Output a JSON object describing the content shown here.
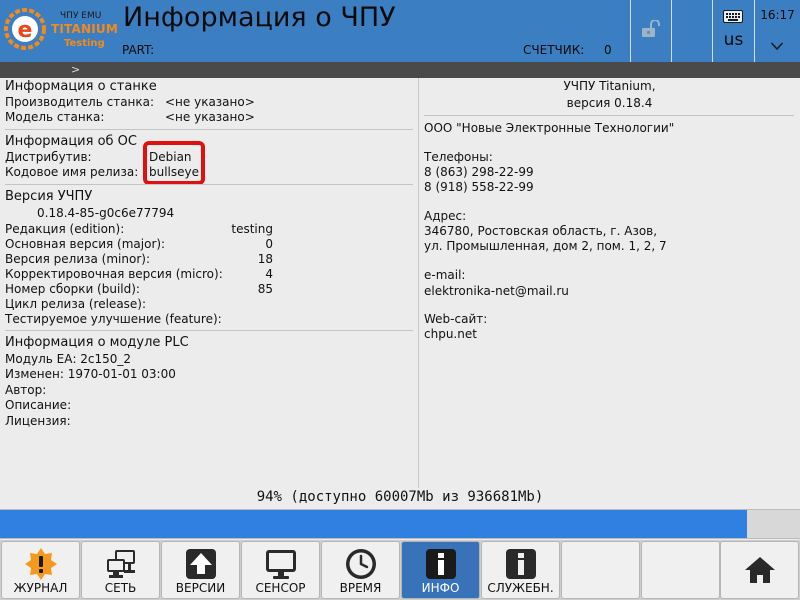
{
  "header": {
    "logo_emu": "ЧПУ EMU",
    "logo_brand": "TITANIUM",
    "logo_testing": "Testing",
    "logo_letter": "e",
    "title": "Информация о ЧПУ",
    "part_label": "PART:",
    "counter_label": "СЧЕТЧИК:",
    "counter_value": "0",
    "keyboard_layout": "us",
    "clock": "16:17",
    "icons": {
      "lock": "unlock-icon",
      "keyboard": "keyboard-icon",
      "chevron": "chevron-down-icon"
    }
  },
  "breadcrumb": {
    "arrow": ">"
  },
  "machine": {
    "heading": "Информация о станке",
    "manufacturer_label": "Производитель станка:",
    "manufacturer_value": "<не указано>",
    "model_label": "Модель станка:",
    "model_value": "<не указано>"
  },
  "os": {
    "heading": "Информация об ОС",
    "distro_label": "Дистрибутив:",
    "distro_value": "Debian",
    "codename_label": "Кодовое имя релиза:",
    "codename_value": "bullseye"
  },
  "cnc_version": {
    "heading": "Версия УЧПУ",
    "full_version": "0.18.4-85-g0c6e77794",
    "rows": [
      {
        "label": "Редакция (edition):",
        "value": "testing"
      },
      {
        "label": "Основная версия (major):",
        "value": "0"
      },
      {
        "label": "Версия релиза  (minor):",
        "value": "18"
      },
      {
        "label": "Корректировочная версия  (micro):",
        "value": "4"
      },
      {
        "label": "Номер сборки  (build):",
        "value": "85"
      },
      {
        "label": "Цикл релиза (release):",
        "value": ""
      },
      {
        "label": "Тестируемое улучшение (feature):",
        "value": ""
      }
    ]
  },
  "plc": {
    "heading": "Информация о модуле PLC",
    "module": "Модуль ЕА: 2c150_2",
    "changed": "Изменен: 1970-01-01 03:00",
    "author": "Автор:",
    "description": "Описание:",
    "license": "Лицензия:"
  },
  "about": {
    "product": "УЧПУ Titanium,",
    "version": "версия 0.18.4",
    "company": "ООО \"Новые Электронные Технологии\"",
    "phones_label": "Телефоны:",
    "phone1": "8 (863) 298-22-99",
    "phone2": "8 (918) 558-22-99",
    "address_label": "Адрес:",
    "address1": "346780, Ростовская область, г. Азов,",
    "address2": "ул. Промышленная, дом 2, пом. 1, 2, 7",
    "email_label": "e-mail:",
    "email": "elektronika-net@mail.ru",
    "web_label": "Web-сайт:",
    "web": "chpu.net"
  },
  "disk": {
    "text": "94% (доступно 60007Mb из 936681Mb)",
    "fraction": 0.934,
    "fill_color": "#2f80e0"
  },
  "toolbar": {
    "items": [
      {
        "label": "ЖУРНАЛ",
        "icon": "warning-icon"
      },
      {
        "label": "СЕТЬ",
        "icon": "network-icon"
      },
      {
        "label": "ВЕРСИИ",
        "icon": "upload-icon"
      },
      {
        "label": "СЕНСОР",
        "icon": "monitor-icon"
      },
      {
        "label": "ВРЕМЯ",
        "icon": "clock-icon"
      },
      {
        "label": "ИНФО",
        "icon": "info-icon",
        "active": true
      },
      {
        "label": "СЛУЖЕБН.",
        "icon": "service-info-icon"
      },
      {
        "label": "",
        "icon": ""
      },
      {
        "label": "",
        "icon": ""
      },
      {
        "label": "",
        "icon": "home-icon"
      }
    ],
    "active_color": "#3873b9"
  },
  "colors": {
    "header_bg": "#3c7ec2",
    "brand_orange": "#f28a1c",
    "annotation_red": "#e01010"
  }
}
